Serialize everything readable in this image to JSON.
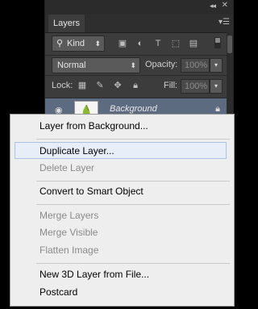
{
  "panel": {
    "tab_label": "Layers",
    "filter": {
      "label": "Kind",
      "icon": "search-icon"
    },
    "blend_mode": "Normal",
    "opacity": {
      "label": "Opacity:",
      "value": "100%"
    },
    "lock_label": "Lock:",
    "fill": {
      "label": "Fill:",
      "value": "100%"
    },
    "layer": {
      "name": "Background",
      "icons": [
        "eye-icon",
        "lock-icon"
      ]
    }
  },
  "menu": {
    "items": [
      {
        "label": "Layer from Background..."
      },
      {
        "label": "Duplicate Layer...",
        "state": "hover"
      },
      {
        "label": "Delete Layer",
        "state": "disabled"
      },
      {
        "label": "Convert to Smart Object"
      },
      {
        "label": "Merge Layers",
        "state": "disabled"
      },
      {
        "label": "Merge Visible",
        "state": "disabled"
      },
      {
        "label": "Flatten Image",
        "state": "disabled"
      },
      {
        "label": "New 3D Layer from File..."
      },
      {
        "label": "Postcard"
      }
    ]
  },
  "colors": {
    "panel_bg": "#3c3c3c",
    "selected_layer": "#5d6b80",
    "menu_bg": "#eeeeee",
    "menu_hover": "#e7eef8"
  }
}
